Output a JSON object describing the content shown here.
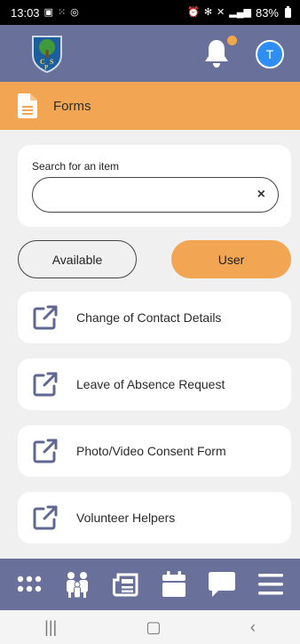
{
  "status_bar": {
    "time": "13:03",
    "battery": "83%"
  },
  "header": {
    "avatar_initial": "T"
  },
  "forms_bar": {
    "title": "Forms"
  },
  "search": {
    "label": "Search for an item",
    "value": "",
    "placeholder": "",
    "clear": "×"
  },
  "toggles": {
    "available": "Available",
    "user": "User"
  },
  "items": [
    {
      "label": "Change of  Contact Details"
    },
    {
      "label": "Leave of Absence Request"
    },
    {
      "label": "Photo/Video Consent Form"
    },
    {
      "label": "Volunteer Helpers"
    }
  ],
  "colors": {
    "header": "#69719a",
    "accent": "#f2a553",
    "avatar": "#2f8ef4"
  },
  "icons": {
    "bottom_nav": [
      "apps-grid-icon",
      "people-icon",
      "news-icon",
      "calendar-icon",
      "chat-icon",
      "menu-icon"
    ]
  }
}
